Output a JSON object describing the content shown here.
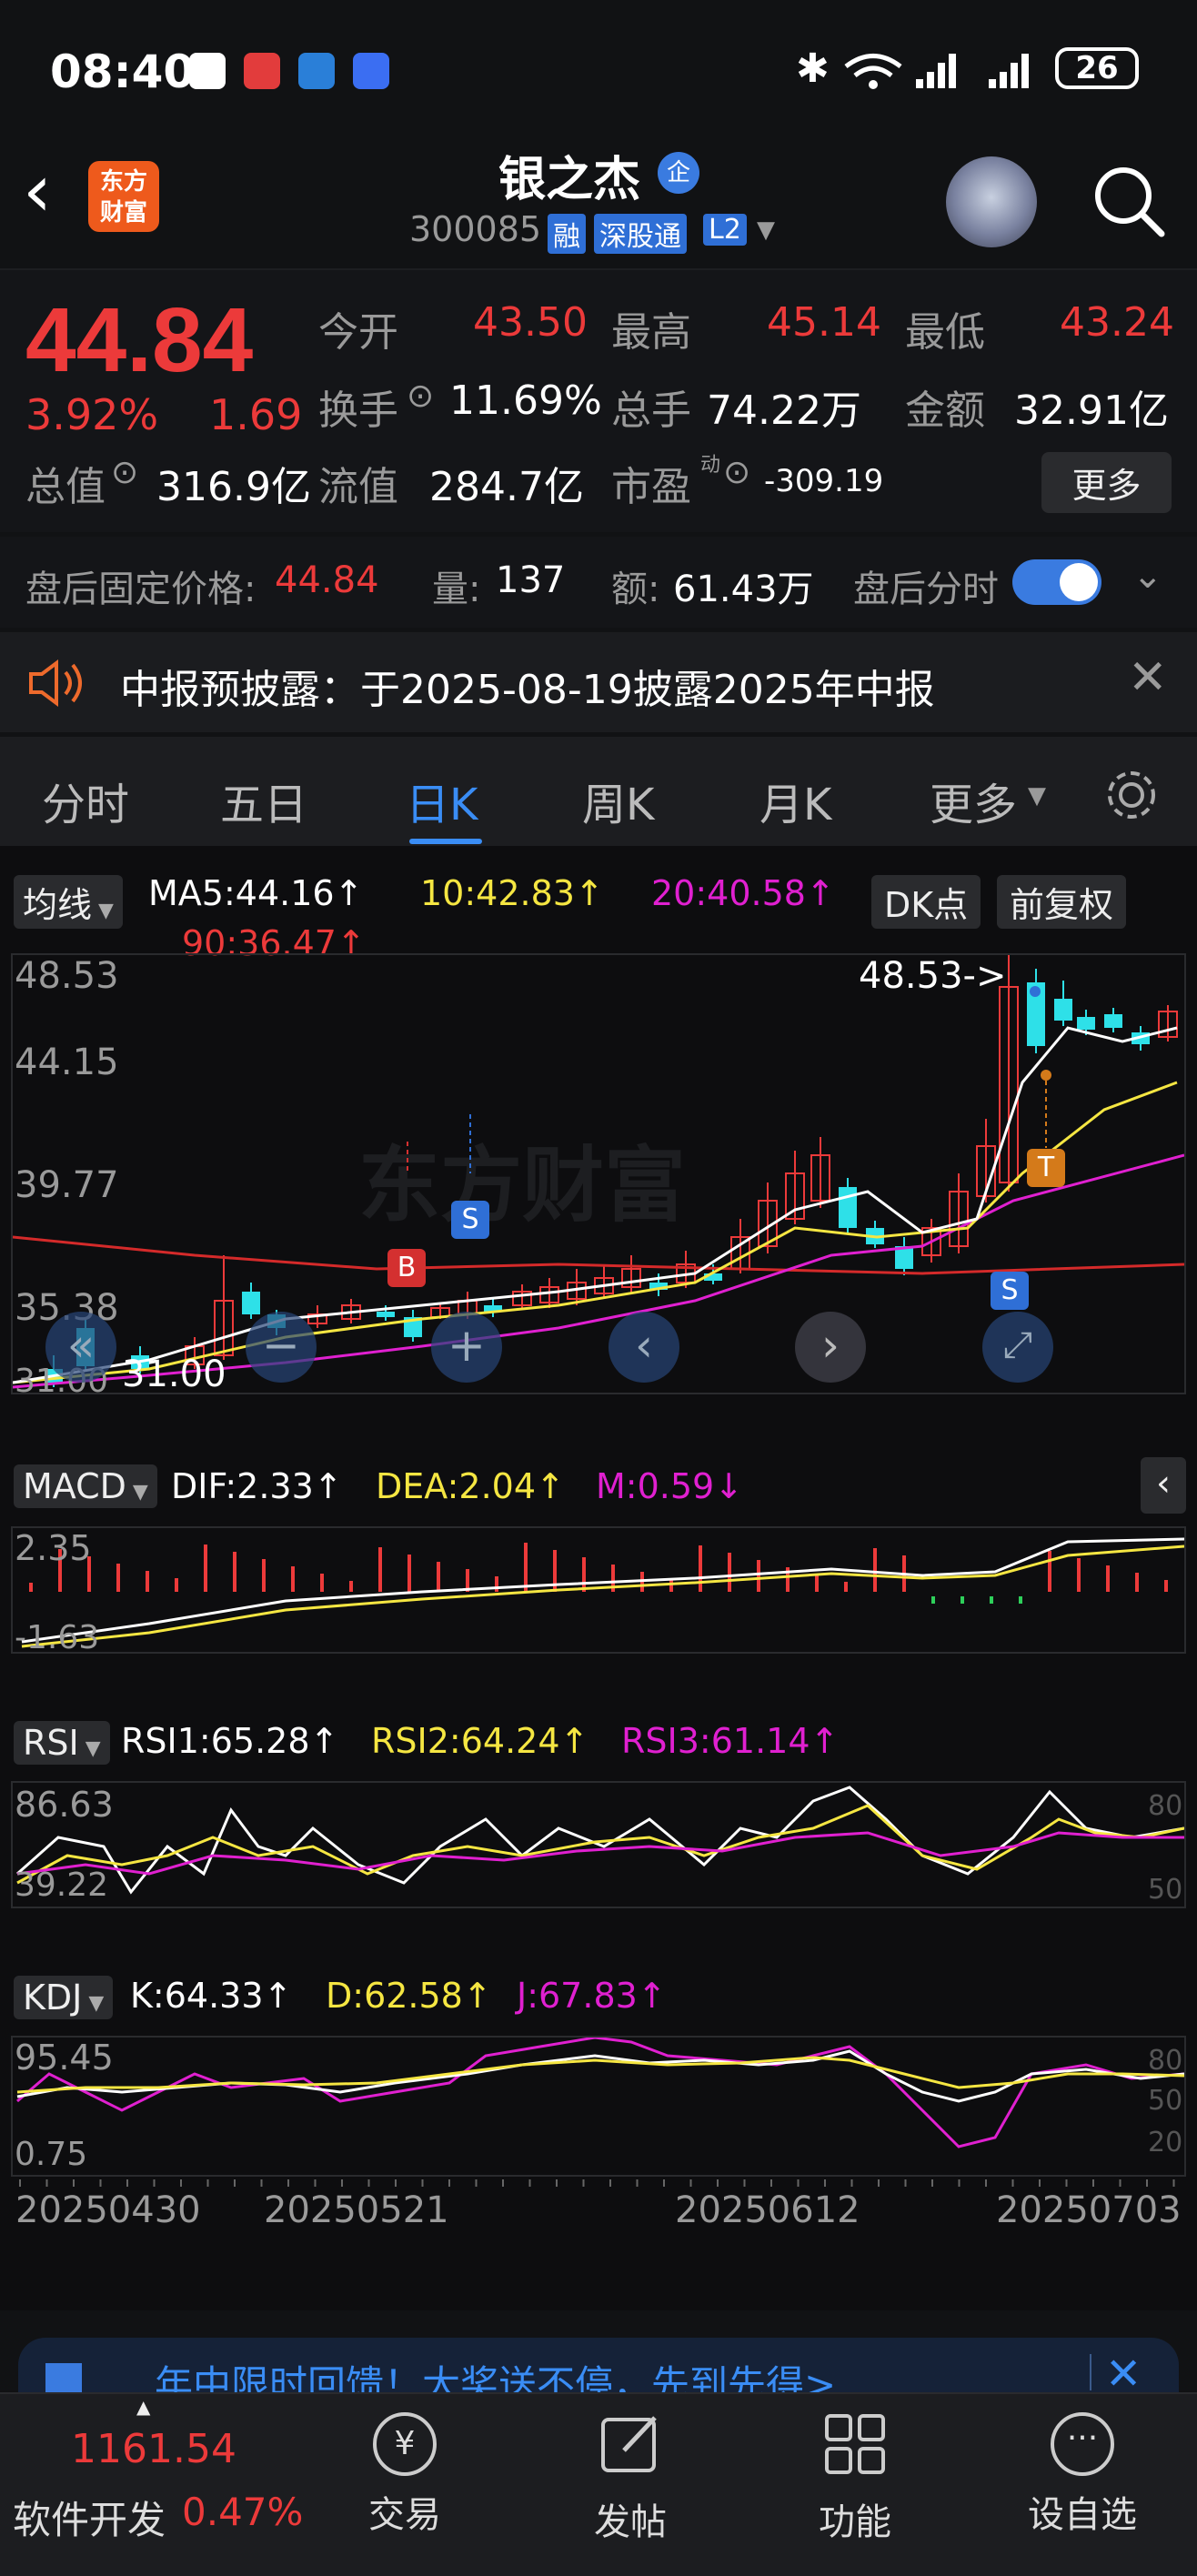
{
  "status_bar": {
    "time": "08:40",
    "battery": "26"
  },
  "header": {
    "logo_line1": "东方",
    "logo_line2": "财富",
    "title": "银之杰",
    "badge": "企",
    "code": "300085",
    "tags": [
      "融",
      "深股通",
      "L2"
    ]
  },
  "quote": {
    "price": "44.84",
    "change_pct": "3.92%",
    "change_abs": "1.69",
    "row1": [
      {
        "label": "今开",
        "value": "43.50"
      },
      {
        "label": "最高",
        "value": "45.14"
      },
      {
        "label": "最低",
        "value": "43.24"
      }
    ],
    "row2": [
      {
        "label": "换手",
        "value": "11.69%"
      },
      {
        "label": "总手",
        "value": "74.22万"
      },
      {
        "label": "金额",
        "value": "32.91亿"
      }
    ],
    "row3": [
      {
        "label": "总值",
        "value": "316.9亿"
      },
      {
        "label": "流值",
        "value": "284.7亿"
      },
      {
        "label": "市盈",
        "sup": "动",
        "value": "-309.19"
      }
    ],
    "more_label": "更多"
  },
  "after_hours": {
    "price_label": "盘后固定价格:",
    "price_value": "44.84",
    "vol_label": "量:",
    "vol_value": "137",
    "amt_label": "额:",
    "amt_value": "61.43万",
    "toggle_label": "盘后分时"
  },
  "notice": {
    "text": "中报预披露：于2025-08-19披露2025年中报"
  },
  "tabs": [
    "分时",
    "五日",
    "日K",
    "周K",
    "月K",
    "更多"
  ],
  "active_tab": "日K",
  "kline": {
    "indicator_select": "均线",
    "ma5": "MA5:44.16↑",
    "ma10": "10:42.83↑",
    "ma20": "20:40.58↑",
    "ma90": "90:36.47↑",
    "dk_label": "DK点",
    "adjust_label": "前复权",
    "y_ticks": [
      "48.53",
      "44.15",
      "39.77",
      "35.38",
      "31.00"
    ],
    "high_marker": "48.53->",
    "low_marker": "31.00",
    "watermark": "东方财富",
    "markers": {
      "b": "B",
      "s": "S",
      "t": "T"
    }
  },
  "macd": {
    "select": "MACD",
    "dif": "DIF:2.33↑",
    "dea": "DEA:2.04↑",
    "m": "M:0.59↓",
    "y_top": "2.35",
    "y_bottom": "-1.63"
  },
  "rsi": {
    "select": "RSI",
    "rsi1": "RSI1:65.28↑",
    "rsi2": "RSI2:64.24↑",
    "rsi3": "RSI3:61.14↑",
    "y_top": "86.63",
    "y_bottom": "39.22",
    "ref_top": "80",
    "ref_bottom": "50"
  },
  "kdj": {
    "select": "KDJ",
    "k": "K:64.33↑",
    "d": "D:62.58↑",
    "j": "J:67.83↑",
    "y_top": "95.45",
    "y_bottom": "0.75",
    "ref80": "80",
    "ref50": "50",
    "ref20": "20"
  },
  "dates": [
    "20250430",
    "20250521",
    "20250612",
    "20250703"
  ],
  "banner": {
    "text": "年中限时回馈！大奖送不停，先到先得>"
  },
  "bottom_nav": {
    "index_value": "1161.54",
    "index_name": "软件开发",
    "index_change": "0.47%",
    "items": [
      "交易",
      "发帖",
      "功能",
      "设自选"
    ]
  },
  "colors": {
    "up": "#ec3a3a",
    "down": "#2ee0e8",
    "ma5": "#ffffff",
    "ma10": "#f5e642",
    "ma20": "#e020d0",
    "ma90": "#d42a2a",
    "accent": "#3a8df5"
  }
}
